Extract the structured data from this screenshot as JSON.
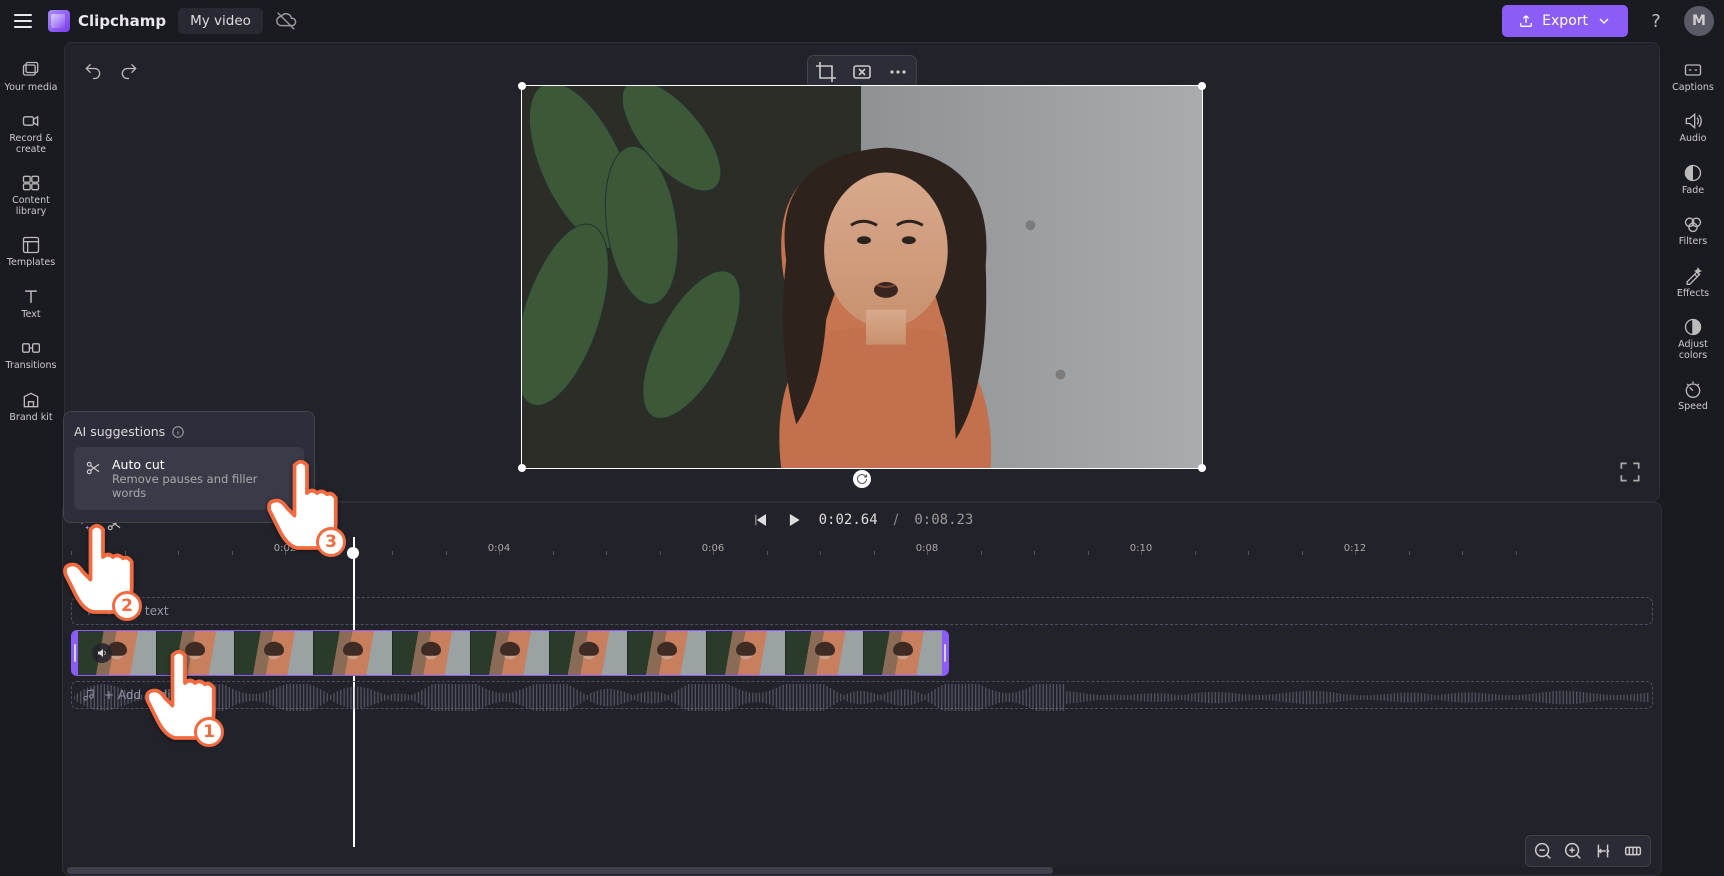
{
  "header": {
    "app_name": "Clipchamp",
    "project_title": "My video",
    "export_label": "Export",
    "help_tooltip": "?",
    "avatar_initial": "M"
  },
  "left_rail": [
    {
      "id": "your-media",
      "label": "Your media"
    },
    {
      "id": "record",
      "label": "Record & create"
    },
    {
      "id": "content-library",
      "label": "Content library"
    },
    {
      "id": "templates",
      "label": "Templates"
    },
    {
      "id": "text",
      "label": "Text"
    },
    {
      "id": "transitions",
      "label": "Transitions"
    },
    {
      "id": "brand-kit",
      "label": "Brand kit"
    }
  ],
  "right_rail": [
    {
      "id": "captions",
      "label": "Captions"
    },
    {
      "id": "audio",
      "label": "Audio"
    },
    {
      "id": "fade",
      "label": "Fade"
    },
    {
      "id": "filters",
      "label": "Filters"
    },
    {
      "id": "effects",
      "label": "Effects"
    },
    {
      "id": "adjust-colors",
      "label": "Adjust colors"
    },
    {
      "id": "speed",
      "label": "Speed"
    }
  ],
  "ai_popup": {
    "heading": "AI suggestions",
    "item_title": "Auto cut",
    "item_desc": "Remove pauses and filler words"
  },
  "playback": {
    "current": "0:02.64",
    "separator": "/",
    "total": "0:08.23"
  },
  "ruler_labels": [
    "0:02",
    "0:04",
    "0:06",
    "0:08",
    "0:10",
    "0:12"
  ],
  "tracks": {
    "text_placeholder": "+ Add text",
    "audio_placeholder": "+ Add audio"
  },
  "annotations": {
    "step1": "1",
    "step2": "2",
    "step3": "3"
  }
}
